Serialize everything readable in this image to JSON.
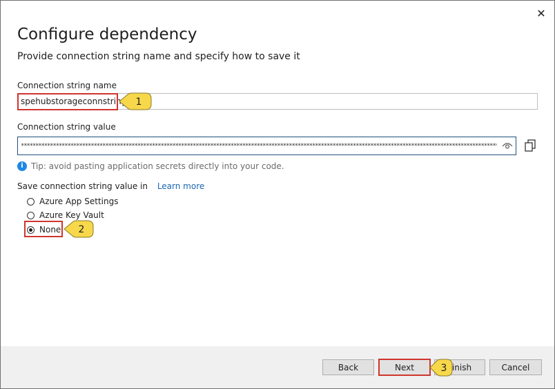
{
  "dialog": {
    "title": "Configure dependency",
    "subtitle": "Provide connection string name and specify how to save it",
    "close_glyph": "✕"
  },
  "connection_name": {
    "label": "Connection string name",
    "value": "spehubstorageconnstring"
  },
  "connection_value": {
    "label": "Connection string value",
    "value": "*****************************************************************************************************************************************************************************"
  },
  "tip": {
    "icon": "info-icon",
    "text": "Tip: avoid pasting application secrets directly into your code."
  },
  "save": {
    "label": "Save connection string value in",
    "learn_more": "Learn more",
    "options": [
      {
        "label": "Azure App Settings",
        "selected": false
      },
      {
        "label": "Azure Key Vault",
        "selected": false
      },
      {
        "label": "None",
        "selected": true
      }
    ]
  },
  "callouts": [
    "1",
    "2",
    "3"
  ],
  "buttons": {
    "back": "Back",
    "next": "Next",
    "finish": "Finish",
    "cancel": "Cancel"
  },
  "colors": {
    "highlight": "#d0342c",
    "callout_fill": "#f7d84a",
    "link": "#1a66b3",
    "footer": "#f0f0f0"
  }
}
